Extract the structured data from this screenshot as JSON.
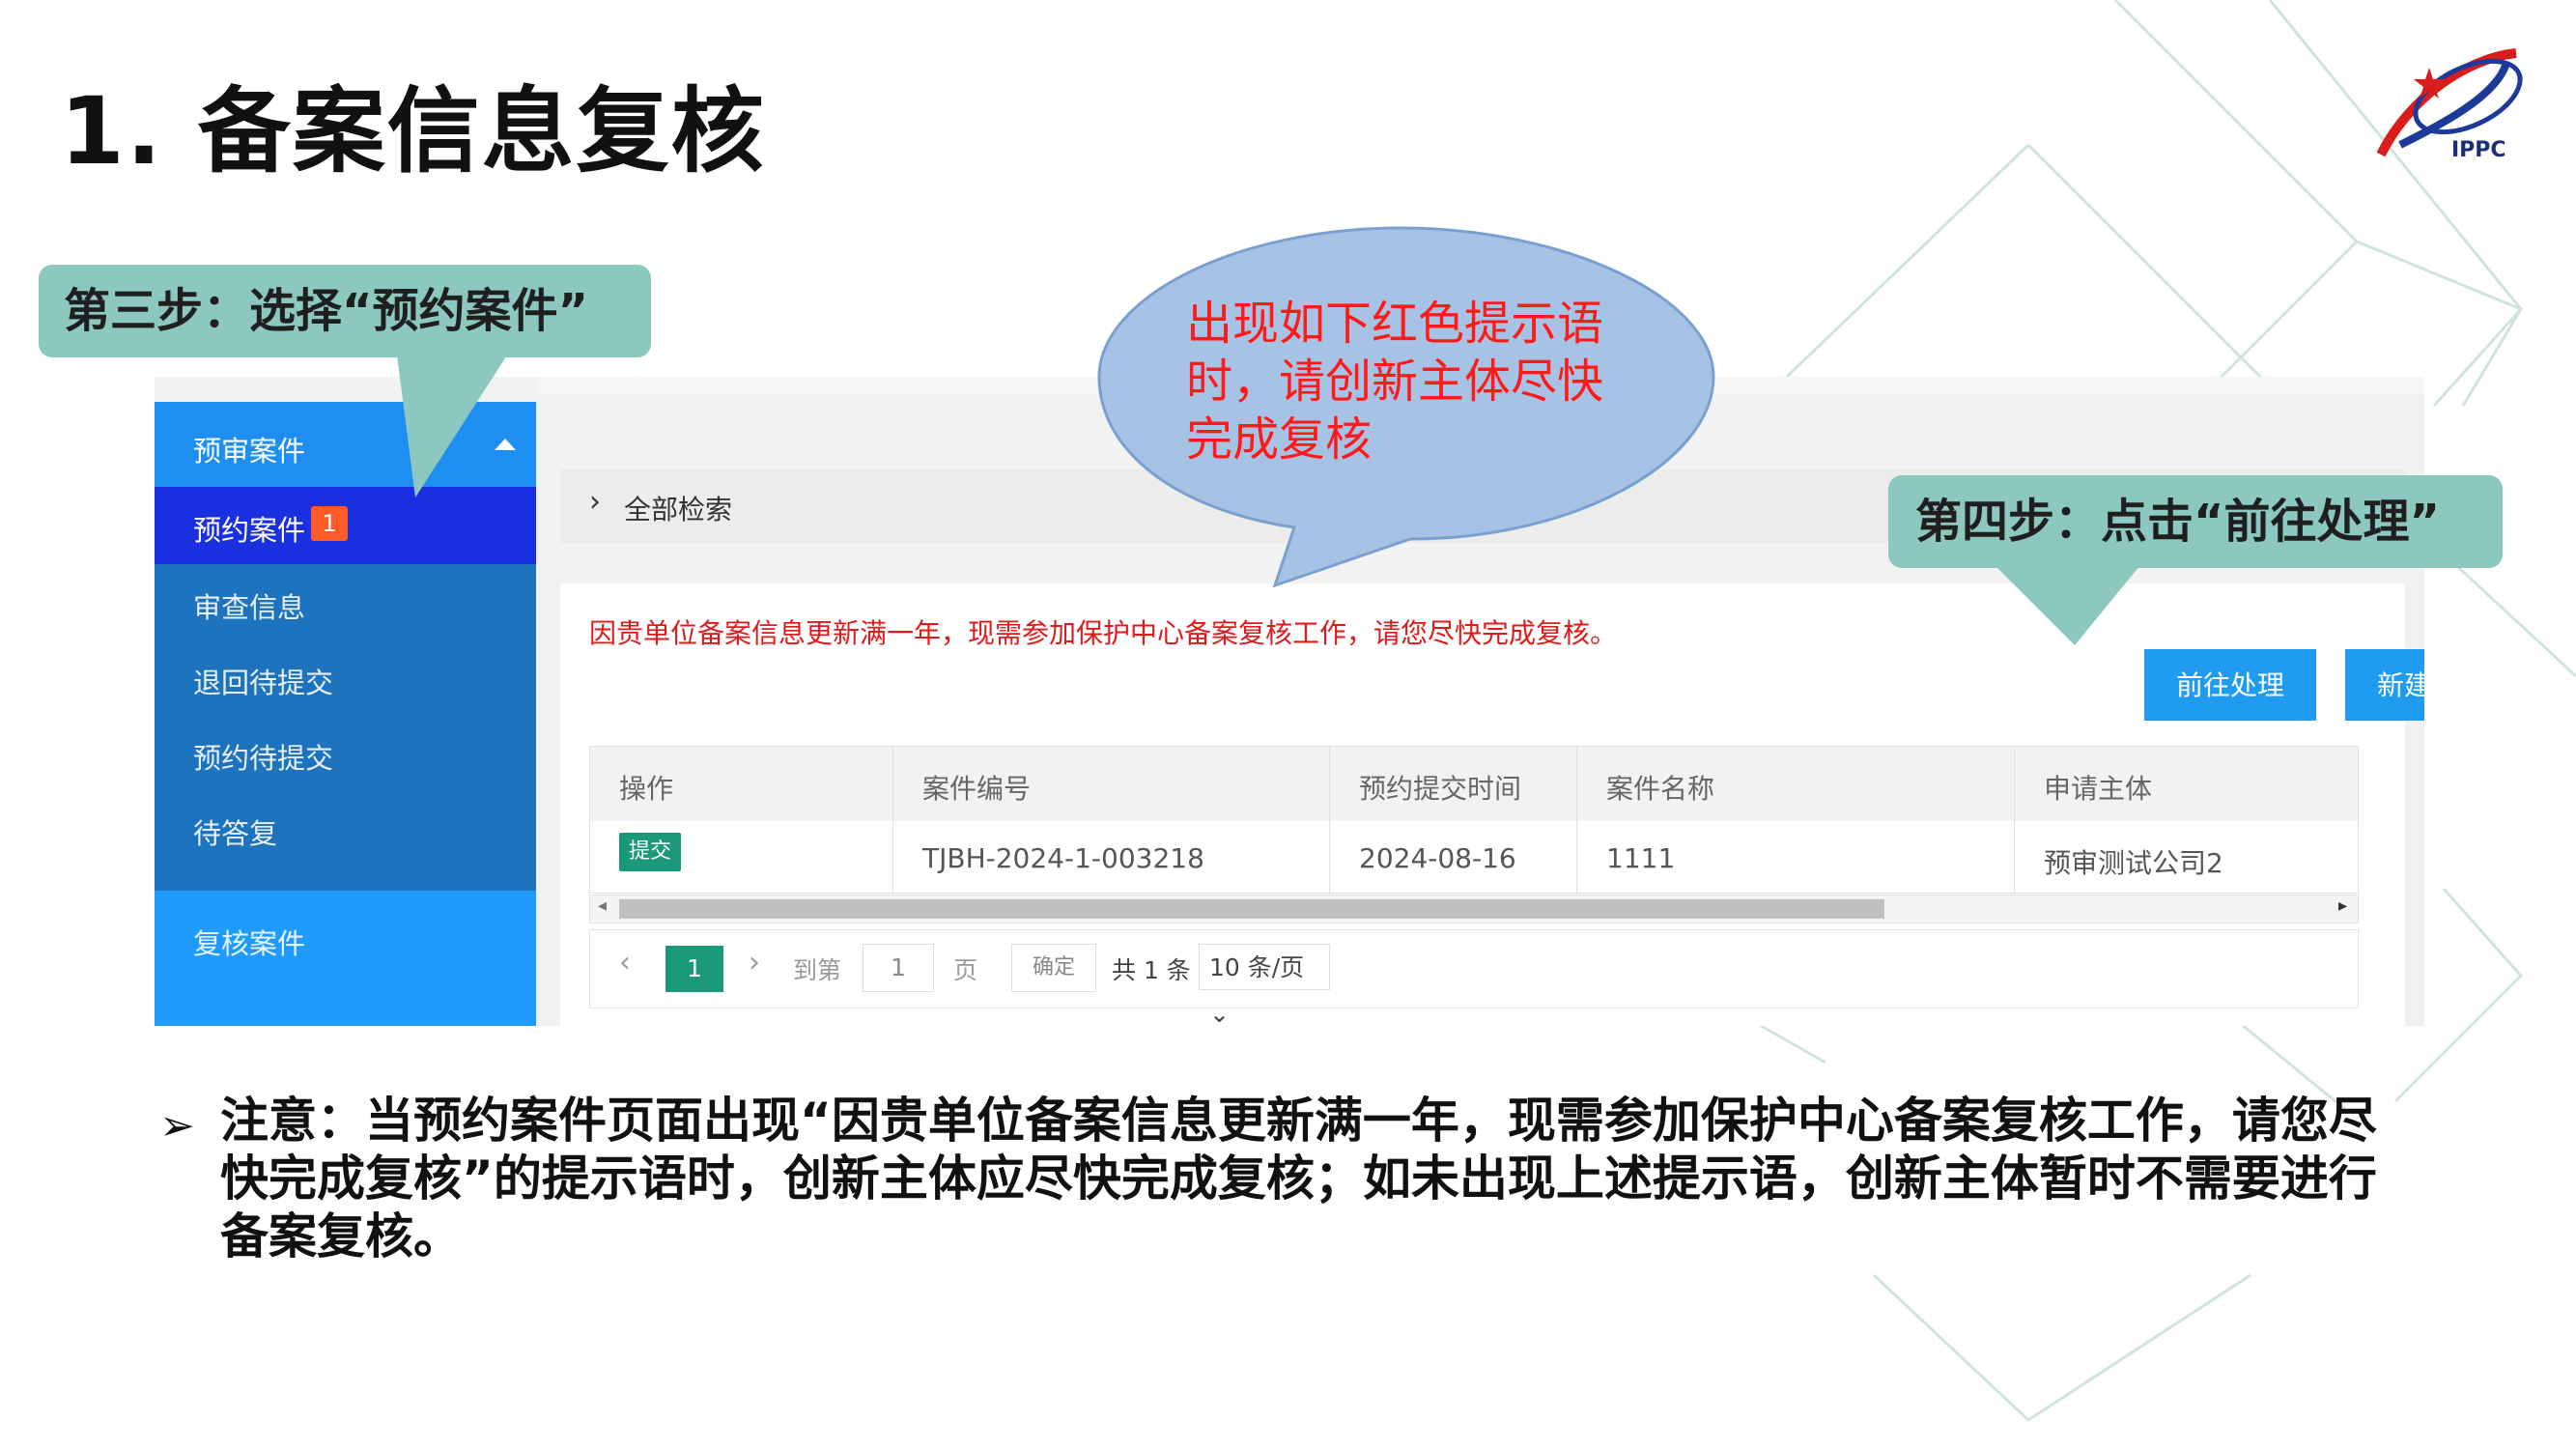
{
  "slide": {
    "title": "1. 备案信息复核",
    "logo_text": "IPPC"
  },
  "callouts": {
    "step3": "第三步：选择“预约案件”",
    "step4": "第四步：点击“前往处理”",
    "bubble_lines": [
      "出现如下红色提示语",
      "时，请创新主体尽快",
      "完成复核"
    ]
  },
  "sidebar": {
    "group1": "预审案件",
    "active_item": "预约案件",
    "active_badge": "1",
    "items": [
      "审查信息",
      "退回待提交",
      "预约待提交",
      "待答复"
    ],
    "group2": "复核案件"
  },
  "search": {
    "label": "全部检索"
  },
  "content": {
    "warning": "因贵单位备案信息更新满一年，现需参加保护中心备案复核工作，请您尽快完成复核。",
    "btn_go": "前往处理",
    "btn_new": "新建预约"
  },
  "table": {
    "headers": [
      "操作",
      "案件编号",
      "预约提交时间",
      "案件名称",
      "申请主体"
    ],
    "rows": [
      {
        "action": "提交",
        "case_no": "TJBH-2024-1-003218",
        "submit_time": "2024-08-16",
        "case_name": "1111",
        "applicant": "预审测试公司2"
      }
    ]
  },
  "pager": {
    "current": "1",
    "goto_label": "到第",
    "goto_value": "1",
    "page_unit": "页",
    "confirm": "确定",
    "total": "共 1 条",
    "page_size": "10 条/页"
  },
  "note": "注意：当预约案件页面出现“因贵单位备案信息更新满一年，现需参加保护中心备案复核工作，请您尽快完成复核”的提示语时，创新主体应尽快完成复核；如未出现上述提示语，创新主体暂时不需要进行备案复核。",
  "colors": {
    "teal_callout": "#8cc8c0",
    "bubble_fill": "#a6c3e6",
    "sidebar_blue": "#1e73be",
    "active_blue": "#1a2fe0",
    "button_blue": "#1f9bf0",
    "warning_red": "#e01a1a",
    "green_tag": "#1a9878"
  }
}
